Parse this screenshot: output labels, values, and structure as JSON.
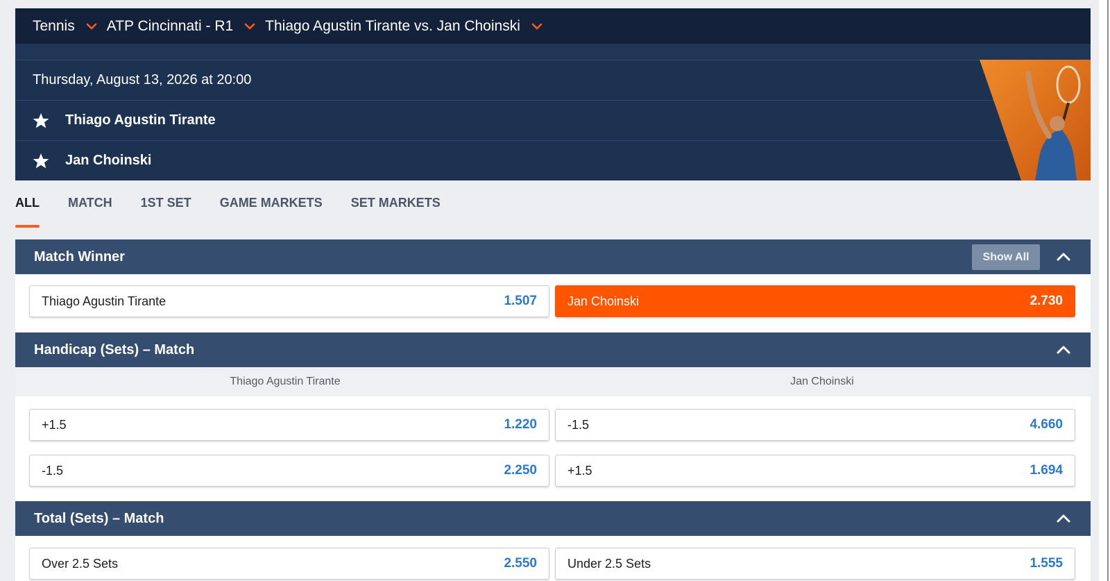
{
  "breadcrumb": {
    "sport": "Tennis",
    "tournament": "ATP Cincinnati - R1",
    "event": "Thiago Agustin Tirante vs. Jan Choinski"
  },
  "event": {
    "datetime": "Thursday, August 13, 2026 at 20:00",
    "player1": "Thiago Agustin Tirante",
    "player2": "Jan Choinski"
  },
  "tabs": [
    "ALL",
    "MATCH",
    "1ST SET",
    "GAME MARKETS",
    "SET MARKETS"
  ],
  "markets": {
    "match_winner": {
      "title": "Match Winner",
      "show_all": "Show All",
      "home": {
        "label": "Thiago Agustin Tirante",
        "odds": "1.507"
      },
      "away": {
        "label": "Jan Choinski",
        "odds": "2.730",
        "selected": true
      }
    },
    "handicap": {
      "title": "Handicap (Sets) – Match",
      "col1": "Thiago Agustin Tirante",
      "col2": "Jan Choinski",
      "rows": [
        {
          "home_label": "+1.5",
          "home_odds": "1.220",
          "away_label": "-1.5",
          "away_odds": "4.660"
        },
        {
          "home_label": "-1.5",
          "home_odds": "2.250",
          "away_label": "+1.5",
          "away_odds": "1.694"
        }
      ]
    },
    "total": {
      "title": "Total (Sets) – Match",
      "over": {
        "label": "Over 2.5 Sets",
        "odds": "2.550"
      },
      "under": {
        "label": "Under 2.5 Sets",
        "odds": "1.555"
      }
    }
  },
  "colors": {
    "accent": "#ff5500",
    "odds_blue": "#2a79cf",
    "topbar": "#13213a",
    "event_panel": "#1c3250",
    "market_header": "#354d6e"
  }
}
